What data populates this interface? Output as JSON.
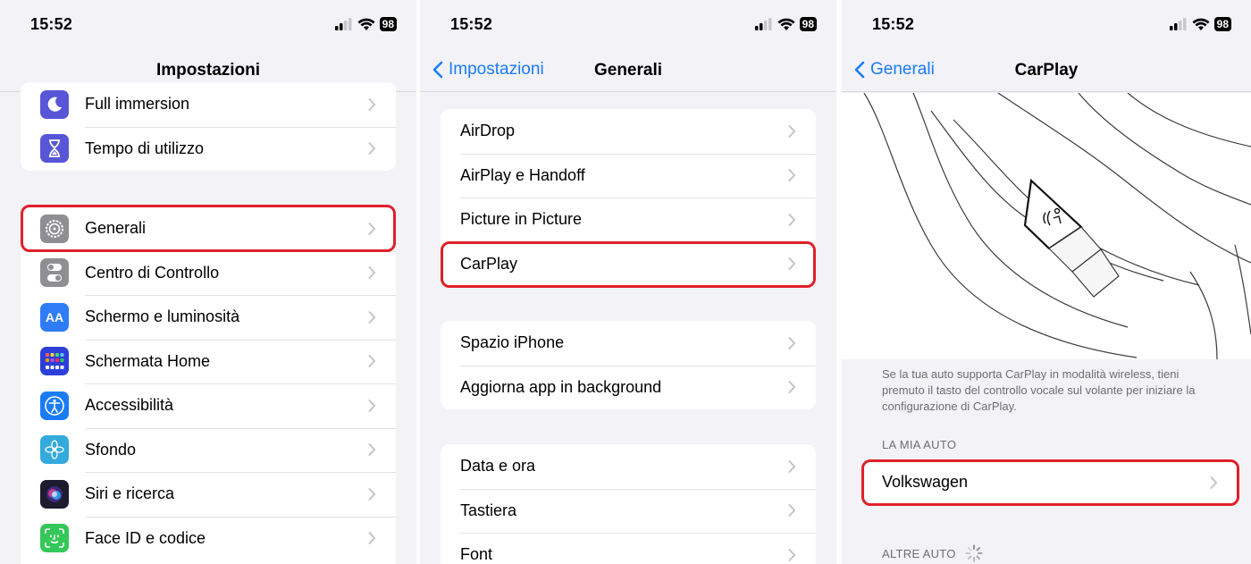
{
  "status": {
    "time": "15:52",
    "battery": "98"
  },
  "panel1": {
    "title": "Impostazioni",
    "group_top": [
      {
        "label": "Full immersion",
        "icon": "moon-icon"
      },
      {
        "label": "Tempo di utilizzo",
        "icon": "hourglass-icon"
      }
    ],
    "group_main": [
      {
        "label": "Generali",
        "icon": "gear-icon"
      },
      {
        "label": "Centro di Controllo",
        "icon": "toggles-icon"
      },
      {
        "label": "Schermo e luminosità",
        "icon": "text-size-icon",
        "icon_text": "AA"
      },
      {
        "label": "Schermata Home",
        "icon": "app-grid-icon"
      },
      {
        "label": "Accessibilità",
        "icon": "accessibility-icon"
      },
      {
        "label": "Sfondo",
        "icon": "flower-icon"
      },
      {
        "label": "Siri e ricerca",
        "icon": "siri-icon"
      },
      {
        "label": "Face ID e codice",
        "icon": "face-id-icon"
      }
    ]
  },
  "panel2": {
    "back": "Impostazioni",
    "title": "Generali",
    "group1": [
      "AirDrop",
      "AirPlay e Handoff",
      "Picture in Picture",
      "CarPlay"
    ],
    "group2": [
      "Spazio iPhone",
      "Aggiorna app in background"
    ],
    "group3": [
      "Data e ora",
      "Tastiera",
      "Font"
    ]
  },
  "panel3": {
    "back": "Generali",
    "title": "CarPlay",
    "description": "Se la tua auto supporta CarPlay in modalità wireless, tieni premuto il tasto del controllo vocale sul volante per iniziare la configurazione di CarPlay.",
    "my_car_header": "LA MIA AUTO",
    "my_car": "Volkswagen",
    "other_header": "ALTRE AUTO"
  },
  "colors": {
    "accent": "#1a7cf5",
    "highlight": "#e0202a"
  }
}
